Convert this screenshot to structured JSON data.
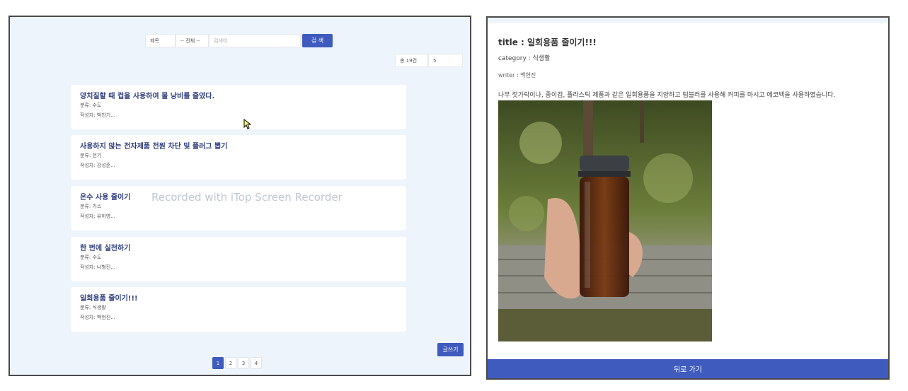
{
  "list": {
    "search": {
      "field_select": "제목",
      "category_select": "-- 전체 --",
      "input_placeholder": "검색어",
      "button_label": "검 색"
    },
    "total_count": "총 19건",
    "page_size": "5",
    "posts": [
      {
        "title": "양치질할 때 컵을 사용하여 물 낭비를 줄였다.",
        "category": "분류: 수도",
        "writer": "작성자: 박찬기..."
      },
      {
        "title": "사용하지 않는 전자제품 전원 차단 및 플러그 뽑기",
        "category": "분류: 전기",
        "writer": "작성자: 강성준..."
      },
      {
        "title": "온수 사용 줄이기",
        "category": "분류: 가스",
        "writer": "작성자: 유하영..."
      },
      {
        "title": "한 번에 실천하기",
        "category": "분류: 수도",
        "writer": "작성자: 나형진..."
      },
      {
        "title": "일회용품 줄이기!!!",
        "category": "분류: 식생활",
        "writer": "작성자: 백현진..."
      }
    ],
    "watermark": "Recorded with iTop Screen Recorder",
    "write_button": "글쓰기",
    "pages": [
      "1",
      "2",
      "3",
      "4"
    ],
    "active_page": "1"
  },
  "detail": {
    "title": "title : 일회용품 줄이기!!!",
    "category": "category : 식생활",
    "writer": "writer : 백현진",
    "content": "나무 젓가락이나, 종이컵, 플라스틱 제품과 같은 일회용품을 지양하고 텀블러를 사용해 커피를 마시고 에코백을 사용하였습니다.",
    "back_button": "뒤로 가기"
  },
  "colors": {
    "accent": "#3f5bbd",
    "panel_bg": "#eef4fb",
    "title_text": "#2f3f80"
  },
  "icons": {
    "cursor": "cursor-icon"
  }
}
